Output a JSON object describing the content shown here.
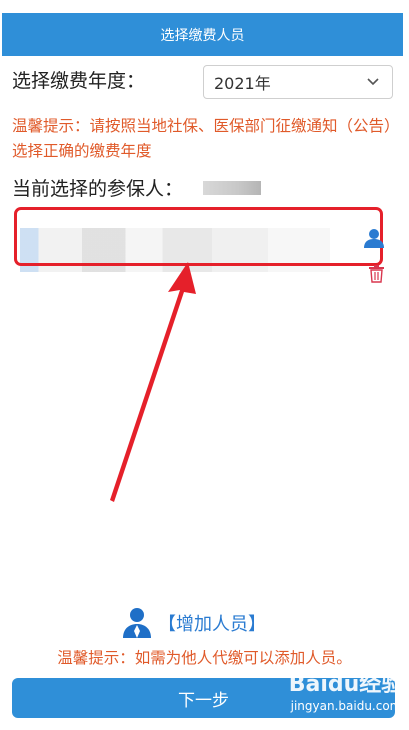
{
  "header": {
    "title": "选择缴费人员"
  },
  "year": {
    "label": "选择缴费年度：",
    "selected": "2021年"
  },
  "tip1": "温馨提示：请按照当地社保、医保部门征缴通知（公告）选择正确的缴费年度",
  "current": {
    "label": "当前选择的参保人："
  },
  "add": {
    "label": "【增加人员】"
  },
  "tip2": "温馨提示：如需为他人代缴可以添加人员。",
  "next": {
    "label": "下一步"
  },
  "watermark": {
    "brand": "Baidu经验",
    "url": "jingyan.baidu.com"
  },
  "colors": {
    "primary": "#2f8fd8",
    "tip": "#e05a2a",
    "highlight": "#e5202a",
    "link": "#2a7bd1"
  },
  "icons": {
    "dropdown": "chevron-down-icon",
    "person": "person-icon",
    "delete": "trash-icon",
    "add_person": "person-add-icon"
  }
}
